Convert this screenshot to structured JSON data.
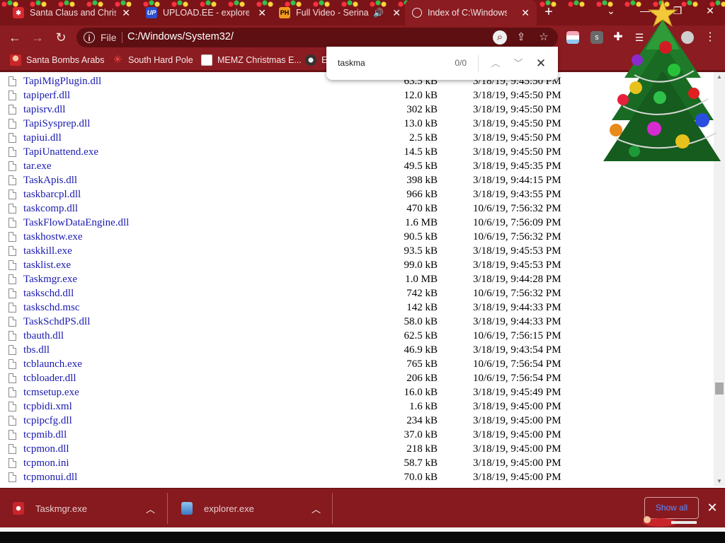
{
  "tabs": [
    {
      "label": "Santa Claus and Christ",
      "favicon": "lights-favicon",
      "active": false
    },
    {
      "label": "UPLOAD.EE - explorer.",
      "favicon": "upload-ee-favicon",
      "favicon_text": "UP",
      "active": false
    },
    {
      "label": "Full Video - Serina",
      "favicon": "ph-favicon",
      "favicon_text": "PH",
      "active": false,
      "audio": true
    },
    {
      "label": "Index of C:\\Windows\\S",
      "favicon": "globe-favicon",
      "active": true
    }
  ],
  "toolbar": {
    "scheme": "File",
    "url": "C:/Windows/System32/"
  },
  "bookmarks": [
    {
      "label": "Santa Bombs Arabs"
    },
    {
      "label": "South Hard Pole"
    },
    {
      "label": "MEMZ Christmas E..."
    },
    {
      "label": "E"
    }
  ],
  "findbar": {
    "query": "taskma",
    "count": "0/0"
  },
  "files": [
    {
      "name": "TapiMigPlugin.dll",
      "size": "63.5 kB",
      "date": "3/18/19, 9:45:50 PM"
    },
    {
      "name": "tapiperf.dll",
      "size": "12.0 kB",
      "date": "3/18/19, 9:45:50 PM"
    },
    {
      "name": "tapisrv.dll",
      "size": "302 kB",
      "date": "3/18/19, 9:45:50 PM"
    },
    {
      "name": "TapiSysprep.dll",
      "size": "13.0 kB",
      "date": "3/18/19, 9:45:50 PM"
    },
    {
      "name": "tapiui.dll",
      "size": "2.5 kB",
      "date": "3/18/19, 9:45:50 PM"
    },
    {
      "name": "TapiUnattend.exe",
      "size": "14.5 kB",
      "date": "3/18/19, 9:45:50 PM"
    },
    {
      "name": "tar.exe",
      "size": "49.5 kB",
      "date": "3/18/19, 9:45:35 PM"
    },
    {
      "name": "TaskApis.dll",
      "size": "398 kB",
      "date": "3/18/19, 9:44:15 PM"
    },
    {
      "name": "taskbarcpl.dll",
      "size": "966 kB",
      "date": "3/18/19, 9:43:55 PM"
    },
    {
      "name": "taskcomp.dll",
      "size": "470 kB",
      "date": "10/6/19, 7:56:32 PM"
    },
    {
      "name": "TaskFlowDataEngine.dll",
      "size": "1.6 MB",
      "date": "10/6/19, 7:56:09 PM"
    },
    {
      "name": "taskhostw.exe",
      "size": "90.5 kB",
      "date": "10/6/19, 7:56:32 PM"
    },
    {
      "name": "taskkill.exe",
      "size": "93.5 kB",
      "date": "3/18/19, 9:45:53 PM"
    },
    {
      "name": "tasklist.exe",
      "size": "99.0 kB",
      "date": "3/18/19, 9:45:53 PM"
    },
    {
      "name": "Taskmgr.exe",
      "size": "1.0 MB",
      "date": "3/18/19, 9:44:28 PM"
    },
    {
      "name": "taskschd.dll",
      "size": "742 kB",
      "date": "10/6/19, 7:56:32 PM"
    },
    {
      "name": "taskschd.msc",
      "size": "142 kB",
      "date": "3/18/19, 9:44:33 PM"
    },
    {
      "name": "TaskSchdPS.dll",
      "size": "58.0 kB",
      "date": "3/18/19, 9:44:33 PM"
    },
    {
      "name": "tbauth.dll",
      "size": "62.5 kB",
      "date": "10/6/19, 7:56:15 PM"
    },
    {
      "name": "tbs.dll",
      "size": "46.9 kB",
      "date": "3/18/19, 9:43:54 PM"
    },
    {
      "name": "tcblaunch.exe",
      "size": "765 kB",
      "date": "10/6/19, 7:56:54 PM"
    },
    {
      "name": "tcbloader.dll",
      "size": "206 kB",
      "date": "10/6/19, 7:56:54 PM"
    },
    {
      "name": "tcmsetup.exe",
      "size": "16.0 kB",
      "date": "3/18/19, 9:45:49 PM"
    },
    {
      "name": "tcpbidi.xml",
      "size": "1.6 kB",
      "date": "3/18/19, 9:45:00 PM"
    },
    {
      "name": "tcpipcfg.dll",
      "size": "234 kB",
      "date": "3/18/19, 9:45:00 PM"
    },
    {
      "name": "tcpmib.dll",
      "size": "37.0 kB",
      "date": "3/18/19, 9:45:00 PM"
    },
    {
      "name": "tcpmon.dll",
      "size": "218 kB",
      "date": "3/18/19, 9:45:00 PM"
    },
    {
      "name": "tcpmon.ini",
      "size": "58.7 kB",
      "date": "3/18/19, 9:45:00 PM"
    },
    {
      "name": "tcpmonui.dll",
      "size": "70.0 kB",
      "date": "3/18/19, 9:45:00 PM"
    }
  ],
  "downloads": [
    {
      "name": "Taskmgr.exe",
      "icon": "exe-download-icon"
    },
    {
      "name": "explorer.exe",
      "icon": "explorer-download-icon"
    }
  ],
  "shelf": {
    "show_all": "Show all"
  },
  "colors": {
    "frame": "#8b1c21",
    "tabstrip": "#7a1418",
    "omnibox": "#5e0f12",
    "link": "#1a1ab0",
    "shelf": "#861a1f"
  }
}
